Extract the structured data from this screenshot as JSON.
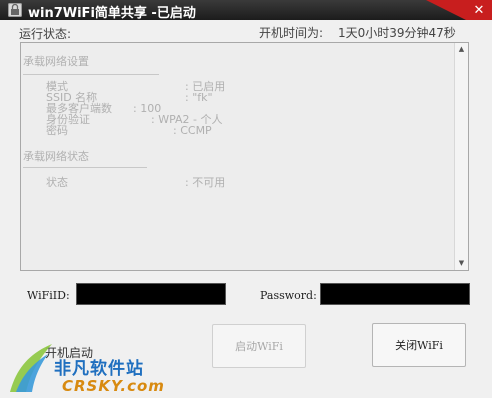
{
  "window": {
    "title": "win7WiFi简单共享 -已启动",
    "close_label": "✕"
  },
  "status": {
    "label": "运行状态:",
    "uptime_label": "开机时间为:",
    "uptime_value": "1天0小时39分钟47秒"
  },
  "log": {
    "section1_header": "承载网络设置",
    "rows1": [
      {
        "key": "模式",
        "value": ": 已启用"
      },
      {
        "key": "SSID 名称",
        "value": ": \"fk\""
      },
      {
        "key": "最多客户端数",
        "value": ": 100"
      },
      {
        "key": "身份验证",
        "value": ": WPA2 - 个人"
      },
      {
        "key": "密码",
        "value": ": CCMP"
      }
    ],
    "section2_header": "承载网络状态",
    "rows2": [
      {
        "key": "状态",
        "value": ": 不可用"
      }
    ]
  },
  "fields": {
    "wifi_id_label": "WiFiID:",
    "wifi_id_value": "",
    "password_label": "Password:",
    "password_value": ""
  },
  "controls": {
    "autostart_label": "开机启动",
    "start_button": "启动WiFi",
    "stop_button": "关闭WiFi"
  },
  "watermark": {
    "text_cn": "非凡软件站",
    "text_en": "CRSKY.com"
  },
  "colors": {
    "title_bg": "#1c1c1c",
    "close_bg": "#c81e1e",
    "input_bg": "#000000",
    "watermark_blue": "#1f6fbf",
    "watermark_orange": "#d88a10"
  }
}
